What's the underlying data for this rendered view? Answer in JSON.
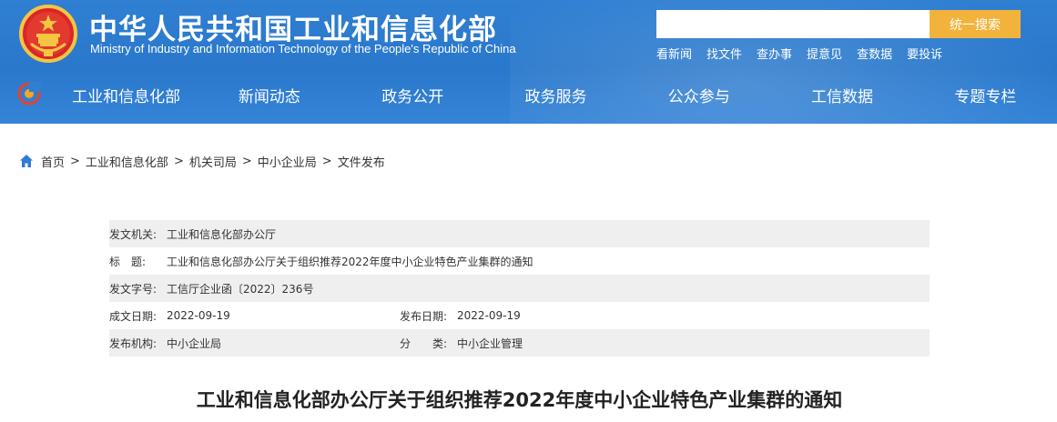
{
  "header": {
    "title": "中华人民共和国工业和信息化部",
    "subtitle": "Ministry of Industry and Information Technology of the People's Republic of China",
    "search": {
      "placeholder": "",
      "button_label": "统一搜索"
    },
    "quick_links": [
      "看新闻",
      "找文件",
      "查办事",
      "提意见",
      "查数据",
      "要投诉"
    ],
    "colors": {
      "banner": "#2f7fd3",
      "search_button": "#f2b33c"
    }
  },
  "nav": {
    "items": [
      "工业和信息化部",
      "新闻动态",
      "政务公开",
      "政务服务",
      "公众参与",
      "工信数据",
      "专题专栏"
    ]
  },
  "breadcrumb": {
    "items": [
      "首页",
      "工业和信息化部",
      "机关司局",
      "中小企业局",
      "文件发布"
    ],
    "separator": ">"
  },
  "document_info": {
    "issuer_label": "发文机关:",
    "issuer": "工业和信息化部办公厅",
    "title_label_1": "标",
    "title_label_2": "题:",
    "title": "工业和信息化部办公厅关于组织推荐2022年度中小企业特色产业集群的通知",
    "doc_number_label": "发文字号:",
    "doc_number": "工信厅企业函〔2022〕236号",
    "created_label": "成文日期:",
    "created_date": "2022-09-19",
    "published_label": "发布日期:",
    "published_date": "2022-09-19",
    "org_label": "发布机构:",
    "org": "中小企业局",
    "category_label": "分　　类:",
    "category": "中小企业管理"
  },
  "article": {
    "title": "工业和信息化部办公厅关于组织推荐2022年度中小企业特色产业集群的通知"
  }
}
